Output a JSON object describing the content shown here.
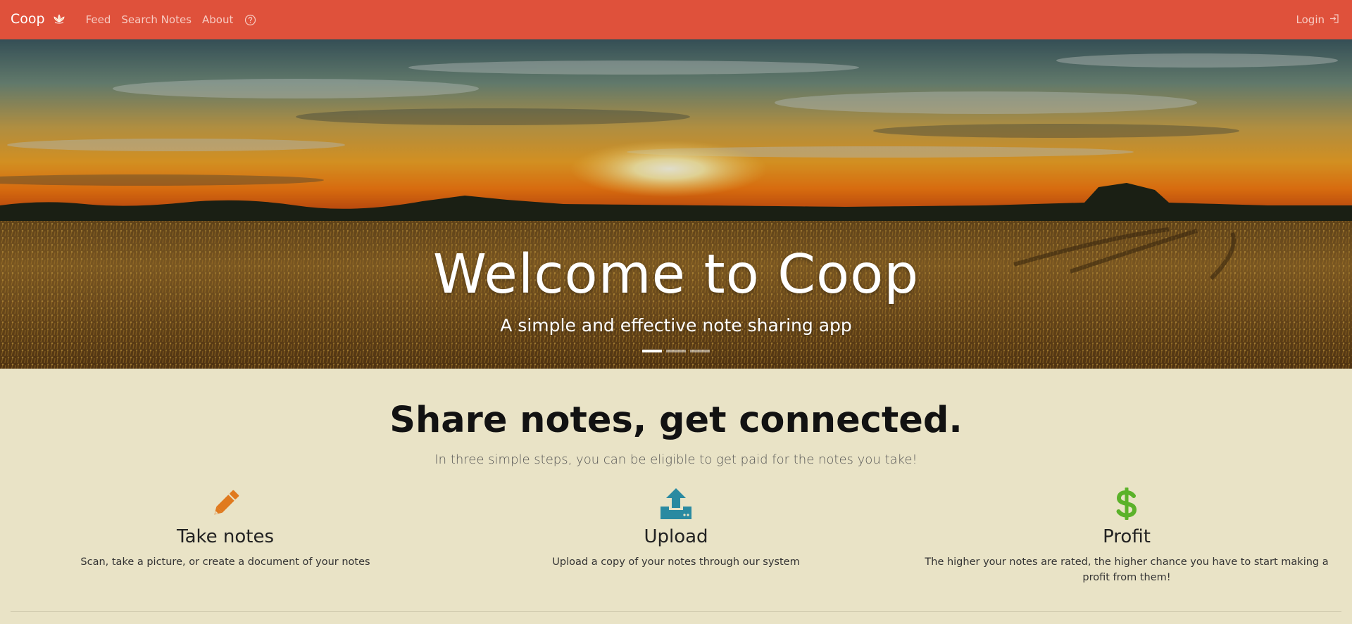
{
  "navbar": {
    "brand": "Coop",
    "links": [
      "Feed",
      "Search Notes",
      "About"
    ],
    "login": "Login",
    "color": "#df513b"
  },
  "hero": {
    "title": "Welcome to Coop",
    "subtitle": "A simple and effective note sharing app",
    "slides_total": 3,
    "active_slide": 1
  },
  "section": {
    "title": "Share notes, get connected.",
    "subtitle": "In three simple steps, you can be eligible to get paid for the notes you take!"
  },
  "steps": [
    {
      "icon": "pencil-icon",
      "title": "Take notes",
      "description": "Scan, take a picture, or create a document of your notes",
      "color": "#e07a1f"
    },
    {
      "icon": "upload-icon",
      "title": "Upload",
      "description": "Upload a copy of your notes through our system",
      "color": "#2a8aa1"
    },
    {
      "icon": "dollar-icon",
      "title": "Profit",
      "description": "The higher your notes are rated, the higher chance you have to start making a profit from them!",
      "color": "#5bb22a"
    }
  ]
}
